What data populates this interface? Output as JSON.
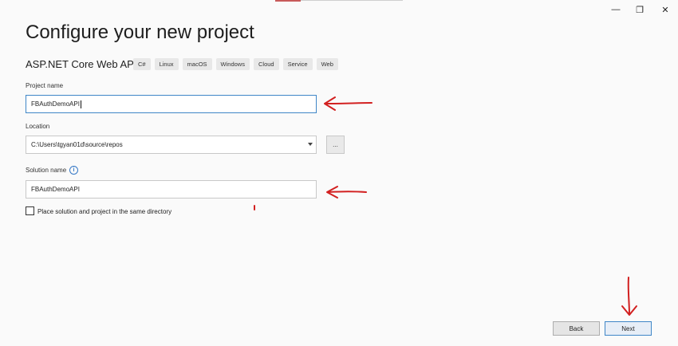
{
  "window": {
    "minimize_glyph": "—",
    "maximize_glyph": "❐",
    "close_glyph": "✕"
  },
  "header": {
    "title": "Configure your new project",
    "template_name": "ASP.NET Core Web API",
    "tags": [
      "C#",
      "Linux",
      "macOS",
      "Windows",
      "Cloud",
      "Service",
      "Web"
    ]
  },
  "form": {
    "project_name_label": "Project name",
    "project_name_value": "FBAuthDemoAPI",
    "location_label": "Location",
    "location_value": "C:\\Users\\tgyan01d\\source\\repos",
    "browse_label": "...",
    "solution_name_label": "Solution name",
    "info_glyph": "i",
    "solution_name_value": "FBAuthDemoAPI",
    "same_dir_label": "Place solution and project in the same directory",
    "same_dir_checked": false
  },
  "footer": {
    "back_label": "Back",
    "next_label": "Next"
  },
  "colors": {
    "accent": "#3f86c7",
    "annotation": "#d22020"
  }
}
